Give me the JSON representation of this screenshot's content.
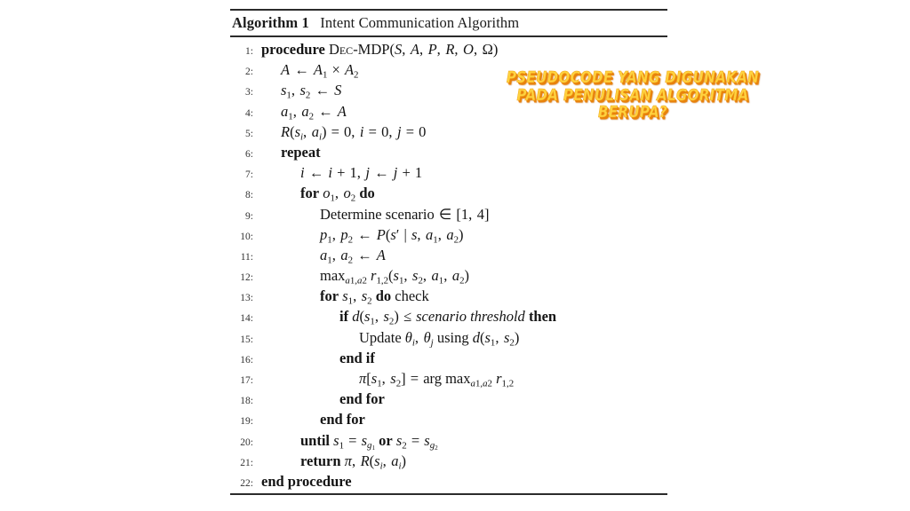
{
  "page": {
    "background_color": "#ffffff",
    "figure_kind": "algorithm-pseudocode-block"
  },
  "algorithm": {
    "label": "Algorithm 1",
    "title": "Intent Communication Algorithm",
    "title_full": "Algorithm 1 Intent Communication Algorithm",
    "rule_color": "#2b2b2b",
    "lines": [
      {
        "number": "1",
        "indent": 0,
        "text": "procedure Dec-MDP(S, A, P, R, O, Ω)"
      },
      {
        "number": "2",
        "indent": 1,
        "text": "A ← A₁ × A₂"
      },
      {
        "number": "3",
        "indent": 1,
        "text": "s₁, s₂ ← S"
      },
      {
        "number": "4",
        "indent": 1,
        "text": "a₁, a₂ ← A"
      },
      {
        "number": "5",
        "indent": 1,
        "text": "R(sᵢ, aᵢ) = 0, i = 0, j = 0"
      },
      {
        "number": "6",
        "indent": 1,
        "text": "repeat"
      },
      {
        "number": "7",
        "indent": 2,
        "text": "i ← i + 1, j ← j + 1"
      },
      {
        "number": "8",
        "indent": 2,
        "text": "for o₁, o₂ do"
      },
      {
        "number": "9",
        "indent": 3,
        "text": "Determine scenario ∈ [1, 4]"
      },
      {
        "number": "10",
        "indent": 3,
        "text": "p₁, p₂ ← P(s′ | s, a₁, a₂)"
      },
      {
        "number": "11",
        "indent": 3,
        "text": "a₁, a₂ ← A"
      },
      {
        "number": "12",
        "indent": 3,
        "text": "max_{a₁,a₂} r₁,₂(s₁, s₂, a₁, a₂)"
      },
      {
        "number": "13",
        "indent": 3,
        "text": "for s₁, s₂ do check"
      },
      {
        "number": "14",
        "indent": 4,
        "text": "if d(s₁, s₂) ≤ scenario threshold then"
      },
      {
        "number": "15",
        "indent": 5,
        "text": "Update θᵢ, θⱼ using d(s₁, s₂)"
      },
      {
        "number": "16",
        "indent": 4,
        "text": "end if"
      },
      {
        "number": "17",
        "indent": 4,
        "text": "π[s₁, s₂] = arg max_{a₁,a₂} r₁,₂"
      },
      {
        "number": "18",
        "indent": 3,
        "text": "end for"
      },
      {
        "number": "19",
        "indent": 2,
        "text": "end for"
      },
      {
        "number": "20",
        "indent": 1,
        "text": "until s₁ = s_{g₁} or s₂ = s_{g₂}"
      },
      {
        "number": "21",
        "indent": 1,
        "text": "return π, R(sᵢ, aᵢ)"
      },
      {
        "number": "22",
        "indent": 0,
        "text": "end procedure"
      }
    ]
  },
  "caption_overlay": {
    "lines": [
      "PSEUDOCODE YANG DIGUNAKAN",
      "PADA PENULISAN ALGORITMA",
      "BERUPA?"
    ],
    "fill_color": "#ffd23f",
    "shadow_color": "#e8820c"
  }
}
